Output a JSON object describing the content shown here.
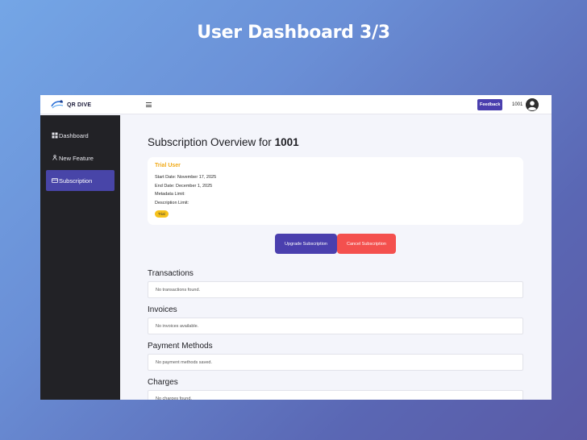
{
  "slide": {
    "title": "User Dashboard 3/3"
  },
  "header": {
    "logo_text": "QR DIVE",
    "menu_icon": "hamburger-icon",
    "feedback_label": "Feedback",
    "user_id": "1001",
    "avatar_icon": "user-avatar-icon"
  },
  "sidebar": {
    "items": [
      {
        "label": "Dashboard",
        "icon": "grid-icon",
        "active": false
      },
      {
        "label": "New Feature",
        "icon": "share-nodes-icon",
        "active": false
      },
      {
        "label": "Subscription",
        "icon": "card-icon",
        "active": true
      }
    ]
  },
  "main": {
    "title_prefix": "Subscription Overview for ",
    "title_user": "1001",
    "subscription": {
      "plan_name": "Trial User",
      "start_date": "Start Date: November 17, 2025",
      "end_date": "End Date: December 1, 2025",
      "metadata_limit": "Metadata Limit:",
      "description_limit": "Description Limit:",
      "badge": "Trial"
    },
    "actions": {
      "upgrade_label": "Upgrade Subscription",
      "cancel_label": "Cancel Subscription"
    },
    "sections": [
      {
        "title": "Transactions",
        "empty_text": "No transactions found."
      },
      {
        "title": "Invoices",
        "empty_text": "No invoices available."
      },
      {
        "title": "Payment Methods",
        "empty_text": "No payment methods saved."
      },
      {
        "title": "Charges",
        "empty_text": "No charges found."
      }
    ]
  },
  "colors": {
    "accent": "#4a3fae",
    "danger": "#f4504e",
    "plan": "#f1a915",
    "sidebar_bg": "#222226"
  }
}
